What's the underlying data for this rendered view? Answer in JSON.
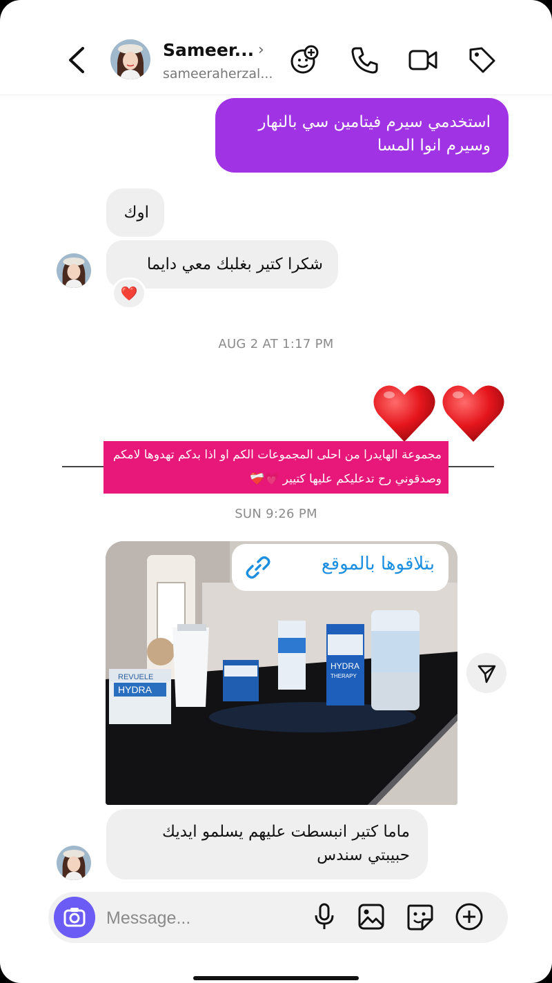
{
  "header": {
    "contact_name": "Sameer...",
    "contact_handle": "sameeraherzal...",
    "chevron": "›",
    "icons": [
      "back-arrow-icon",
      "effects-icon",
      "phone-icon",
      "video-camera-icon",
      "tag-icon"
    ]
  },
  "messages": {
    "outgoing_1": "استخدمي سيرم فيتامين سي بالنهار وسيرم انوا المسا",
    "incoming_ok": "اوك",
    "incoming_thanks": "شكرا كتير بغلبك معي دايما",
    "reaction": "❤️",
    "timestamp_1": "AUG 2 AT 1:17 PM",
    "story_caption": "مجموعة الهايدرا من احلى المجموعات الكم او اذا بدكم تهدوها لامكم وصدقوني رح تدعليكم عليها كتيير 💗❤️‍🩹",
    "timestamp_2": "SUN 9:26 PM",
    "link_sticker": "بتلاقوها بالموقع",
    "incoming_last": "ماما كتير انبسطت عليهم يسلمو ايديك حبيبتي سندس"
  },
  "product_image": {
    "brand_labels": [
      "REVUELE",
      "HYDRA",
      "THERAPY"
    ]
  },
  "composer": {
    "placeholder": "Message...",
    "icons": [
      "camera-icon",
      "microphone-icon",
      "gallery-icon",
      "sticker-icon",
      "plus-icon"
    ]
  },
  "colors": {
    "outgoing_bubble": "#a033e3",
    "incoming_bubble": "#efefef",
    "story_highlight": "#e8177a",
    "camera_button": "#6b5cf6",
    "link_text": "#1d8fe0"
  }
}
